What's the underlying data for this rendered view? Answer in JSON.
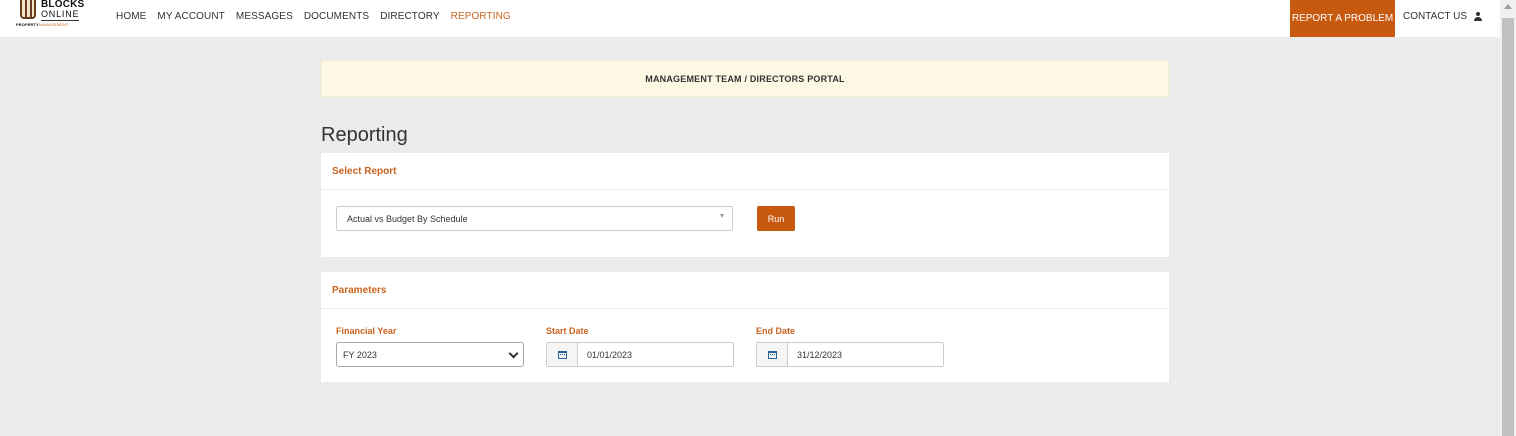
{
  "logo": {
    "line1": "BLOCKS",
    "line2": "ONLINE",
    "tagline_a": "PROPERTY",
    "tagline_b": "MANAGEMENT"
  },
  "nav": {
    "items": [
      {
        "label": "HOME"
      },
      {
        "label": "MY ACCOUNT"
      },
      {
        "label": "MESSAGES"
      },
      {
        "label": "DOCUMENTS"
      },
      {
        "label": "DIRECTORY"
      },
      {
        "label": "REPORTING"
      }
    ],
    "active": "REPORTING",
    "report_problem": "REPORT A PROBLEM",
    "contact_us": "CONTACT US"
  },
  "banner": {
    "text": "MANAGEMENT TEAM / DIRECTORS PORTAL"
  },
  "page": {
    "title": "Reporting"
  },
  "select_report": {
    "heading": "Select Report",
    "selected": "Actual vs Budget By Schedule",
    "run_label": "Run"
  },
  "parameters": {
    "heading": "Parameters",
    "financial_year_label": "Financial Year",
    "financial_year_value": "FY 2023",
    "start_date_label": "Start Date",
    "start_date_value": "01/01/2023",
    "end_date_label": "End Date",
    "end_date_value": "31/12/2023"
  },
  "colors": {
    "accent": "#c85a0f",
    "label_orange": "#c8641e",
    "banner_bg": "#fcf8e3",
    "page_bg": "#ebebeb"
  }
}
